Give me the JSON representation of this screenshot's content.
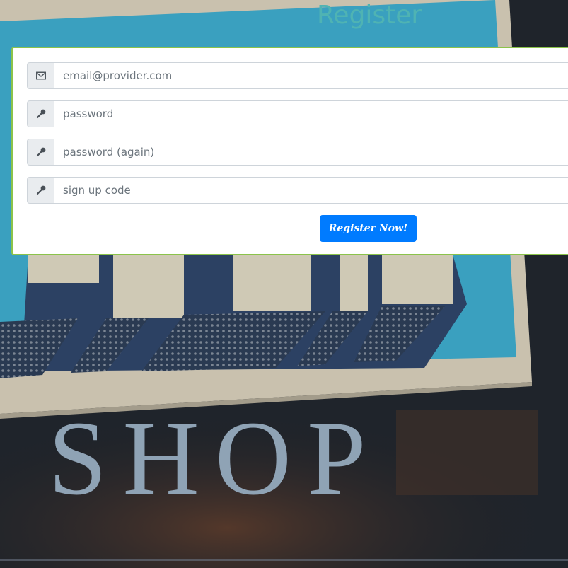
{
  "page": {
    "title": "Register"
  },
  "form": {
    "email": {
      "value": "",
      "placeholder": "email@provider.com",
      "icon": "envelope-icon"
    },
    "password": {
      "value": "",
      "placeholder": "password",
      "icon": "key-icon"
    },
    "password_again": {
      "value": "",
      "placeholder": "password (again)",
      "icon": "key-icon"
    },
    "signup_code": {
      "value": "",
      "placeholder": "sign up code",
      "icon": "key-icon"
    },
    "submit_label": "Register Now!"
  },
  "background": {
    "sign_text": "SHOP"
  },
  "colors": {
    "title": "#4fb3b3",
    "card_border": "#8bc34a",
    "button": "#007bff",
    "addon_bg": "#e9ecef"
  }
}
